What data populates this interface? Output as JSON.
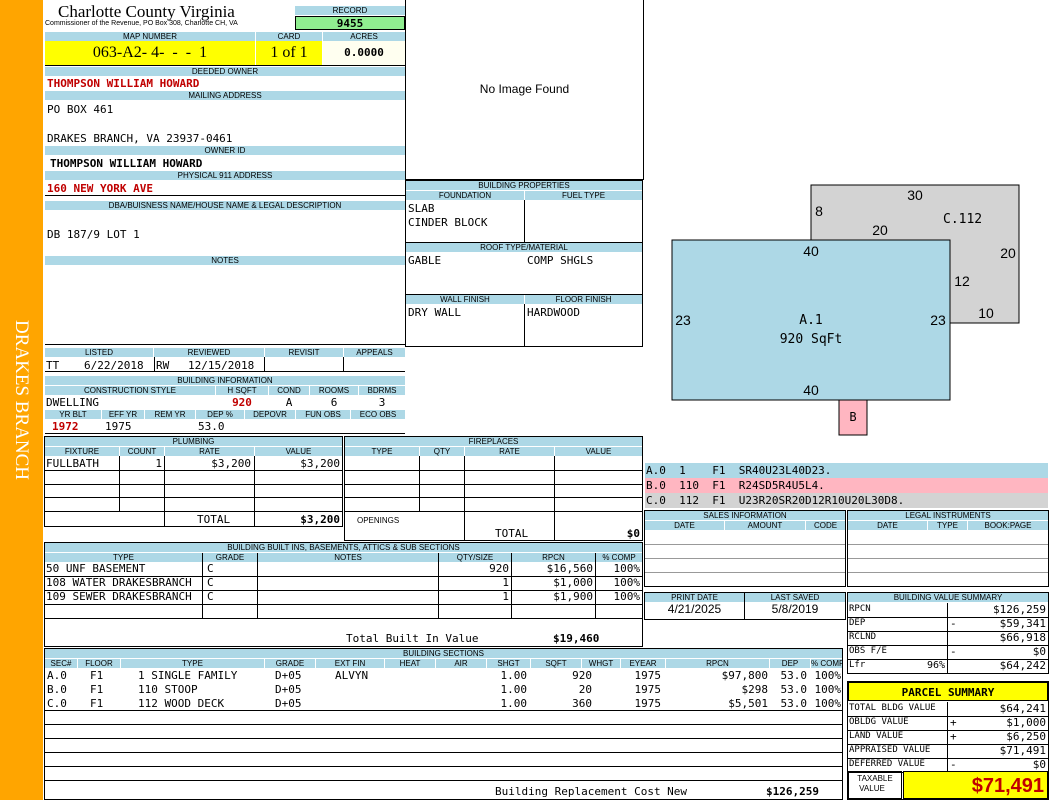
{
  "county": {
    "title": "Charlotte County Virginia",
    "subtitle": "Commissioner of the Revenue, PO Box 308, Charlotte CH, VA"
  },
  "side_label": "DRAKES BRANCH",
  "record": {
    "label": "RECORD",
    "value": "9455"
  },
  "map": {
    "label": "MAP NUMBER",
    "value": "063-A2- 4-  -  -  1",
    "card_label": "CARD",
    "card": "1 of 1",
    "acres_label": "ACRES",
    "acres": "0.0000"
  },
  "owner": {
    "label": "DEEDED OWNER",
    "value": "THOMPSON WILLIAM HOWARD"
  },
  "mailing": {
    "label": "MAILING ADDRESS",
    "line1": "PO BOX 461",
    "line2": "DRAKES BRANCH, VA 23937-0461"
  },
  "owner_id": {
    "label": "OWNER ID",
    "value": "THOMPSON WILLIAM HOWARD"
  },
  "address911": {
    "label": "PHYSICAL 911 ADDRESS",
    "value": "160 NEW YORK AVE"
  },
  "dba": {
    "label": "DBA/BUISNESS NAME/HOUSE NAME & LEGAL DESCRIPTION",
    "value": "DB 187/9 LOT 1"
  },
  "notes": {
    "label": "NOTES"
  },
  "photo": {
    "text": "No Image Found"
  },
  "listing": {
    "listed_label": "LISTED",
    "reviewed_label": "REVIEWED",
    "revisit_label": "REVISIT",
    "appeals_label": "APPEALS",
    "listed_by": "TT",
    "listed_date": "6/22/2018",
    "reviewed_by": "RW",
    "reviewed_date": "12/15/2018"
  },
  "building_info": {
    "label": "BUILDING INFORMATION",
    "style_label": "CONSTRUCTION STYLE",
    "hsqft_label": "H SQFT",
    "cond_label": "COND",
    "rooms_label": "ROOMS",
    "bdrms_label": "BDRMS",
    "style": "DWELLING",
    "hsqft": "920",
    "cond": "A",
    "rooms": "6",
    "bdrms": "3",
    "yrblt_label": "YR BLT",
    "effyr_label": "EFF YR",
    "remyr_label": "REM YR",
    "dep_label": "DEP %",
    "depovr_label": "DEPOVR",
    "funobs_label": "FUN OBS",
    "ecoobs_label": "ECO OBS",
    "yrblt": "1972",
    "effyr": "1975",
    "dep": "53.0"
  },
  "bldg_props": {
    "label": "BUILDING PROPERTIES",
    "foundation_label": "FOUNDATION",
    "fuel_label": "FUEL TYPE",
    "foundation1": "SLAB",
    "foundation2": "CINDER BLOCK",
    "roof_label": "ROOF TYPE/MATERIAL",
    "roof_type": "GABLE",
    "roof_material": "COMP SHGLS",
    "wall_label": "WALL FINISH",
    "floor_label": "FLOOR FINISH",
    "wall": "DRY WALL",
    "floor": "HARDWOOD"
  },
  "sketch": {
    "a_label": "A.1",
    "a_sqft": "920 SqFt",
    "c_label": "C.112",
    "b_label": "B",
    "dims": {
      "a_top": "40",
      "a_bottom": "40",
      "a_left": "23",
      "a_right": "23",
      "c_top": "30",
      "c_8": "8",
      "c_20a": "20",
      "c_20b": "20",
      "c_12": "12",
      "c_10": "10"
    }
  },
  "sketch_legend": [
    {
      "text": "A.0  1    F1  SR40U23L40D23.",
      "color": "#add8e6"
    },
    {
      "text": "B.0  110  F1  R24SD5R4U5L4.",
      "color": "#ffb6c1"
    },
    {
      "text": "C.0  112  F1  U23R20SR20D12R10U20L30D8.",
      "color": "#d3d3d3"
    }
  ],
  "plumbing": {
    "label": "PLUMBING",
    "headers": [
      "FIXTURE",
      "COUNT",
      "RATE",
      "VALUE"
    ],
    "rows": [
      {
        "fixture": "FULLBATH",
        "count": "1",
        "rate": "$3,200",
        "value": "$3,200"
      }
    ],
    "total_label": "TOTAL",
    "total": "$3,200"
  },
  "fireplaces": {
    "label": "FIREPLACES",
    "headers": [
      "TYPE",
      "QTY",
      "RATE",
      "VALUE"
    ],
    "openings_label": "OPENINGS",
    "total_label": "TOTAL",
    "total": "$0"
  },
  "sales": {
    "label": "SALES INFORMATION",
    "headers": [
      "DATE",
      "AMOUNT",
      "CODE"
    ]
  },
  "legal": {
    "label": "LEGAL INSTRUMENTS",
    "headers": [
      "DATE",
      "TYPE",
      "BOOK:PAGE"
    ]
  },
  "builtins": {
    "label": "BUILDING BUILT INS, BASEMENTS, ATTICS & SUB SECTIONS",
    "headers": [
      "TYPE",
      "GRADE",
      "NOTES",
      "QTY/SIZE",
      "RPCN",
      "% COMP"
    ],
    "rows": [
      {
        "type": "50 UNF BASEMENT",
        "grade": "C",
        "qty": "920",
        "rpcn": "$16,560",
        "comp": "100%"
      },
      {
        "type": "108 WATER DRAKESBRANCH",
        "grade": "C",
        "qty": "1",
        "rpcn": "$1,000",
        "comp": "100%"
      },
      {
        "type": "109 SEWER DRAKESBRANCH",
        "grade": "C",
        "qty": "1",
        "rpcn": "$1,900",
        "comp": "100%"
      }
    ],
    "total_label": "Total Built In Value",
    "total": "$19,460"
  },
  "dates": {
    "print_label": "PRINT DATE",
    "print": "4/21/2025",
    "saved_label": "LAST SAVED",
    "saved": "5/8/2019"
  },
  "value_summary": {
    "label": "BUILDING VALUE SUMMARY",
    "rows": [
      {
        "label": "RPCN",
        "sign": "",
        "value": "$126,259"
      },
      {
        "label": "DEP",
        "sign": "-",
        "value": "$59,341"
      },
      {
        "label": "RCLND",
        "sign": "",
        "value": "$66,918"
      },
      {
        "label": "OBS F/E",
        "sign": "-",
        "value": "$0"
      },
      {
        "label": "Lfr",
        "pct": "96%",
        "sign": "",
        "value": "$64,242"
      }
    ]
  },
  "sections": {
    "label": "BUILDING SECTIONS",
    "headers": [
      "SEC#",
      "FLOOR",
      "TYPE",
      "GRADE",
      "EXT FIN",
      "HEAT",
      "AIR",
      "SHGT",
      "SQFT",
      "WHGT",
      "EYEAR",
      "RPCN",
      "DEP",
      "% COMP"
    ],
    "rows": [
      {
        "sec": "A.0",
        "floor": "F1",
        "type": "1 SINGLE FAMILY",
        "grade": "D+05",
        "extfin": "ALVYN",
        "shgt": "1.00",
        "sqft": "920",
        "eyear": "1975",
        "rpcn": "$97,800",
        "dep": "53.0",
        "comp": "100%"
      },
      {
        "sec": "B.0",
        "floor": "F1",
        "type": "110 STOOP",
        "grade": "D+05",
        "extfin": "",
        "shgt": "1.00",
        "sqft": "20",
        "eyear": "1975",
        "rpcn": "$298",
        "dep": "53.0",
        "comp": "100%"
      },
      {
        "sec": "C.0",
        "floor": "F1",
        "type": "112 WOOD DECK",
        "grade": "D+05",
        "extfin": "",
        "shgt": "1.00",
        "sqft": "360",
        "eyear": "1975",
        "rpcn": "$5,501",
        "dep": "53.0",
        "comp": "100%"
      }
    ],
    "replacement_label": "Building Replacement Cost New",
    "replacement": "$126,259"
  },
  "parcel": {
    "label": "PARCEL SUMMARY",
    "rows": [
      {
        "label": "TOTAL BLDG VALUE",
        "sign": "",
        "value": "$64,241"
      },
      {
        "label": "OBLDG VALUE",
        "sign": "+",
        "value": "$1,000"
      },
      {
        "label": "LAND VALUE",
        "sign": "+",
        "value": "$6,250"
      },
      {
        "label": "APPRAISED VALUE",
        "sign": "",
        "value": "$71,491"
      },
      {
        "label": "DEFERRED VALUE",
        "sign": "-",
        "value": "$0"
      }
    ],
    "taxable_label1": "TAXABLE",
    "taxable_label2": "VALUE",
    "taxable": "$71,491"
  }
}
